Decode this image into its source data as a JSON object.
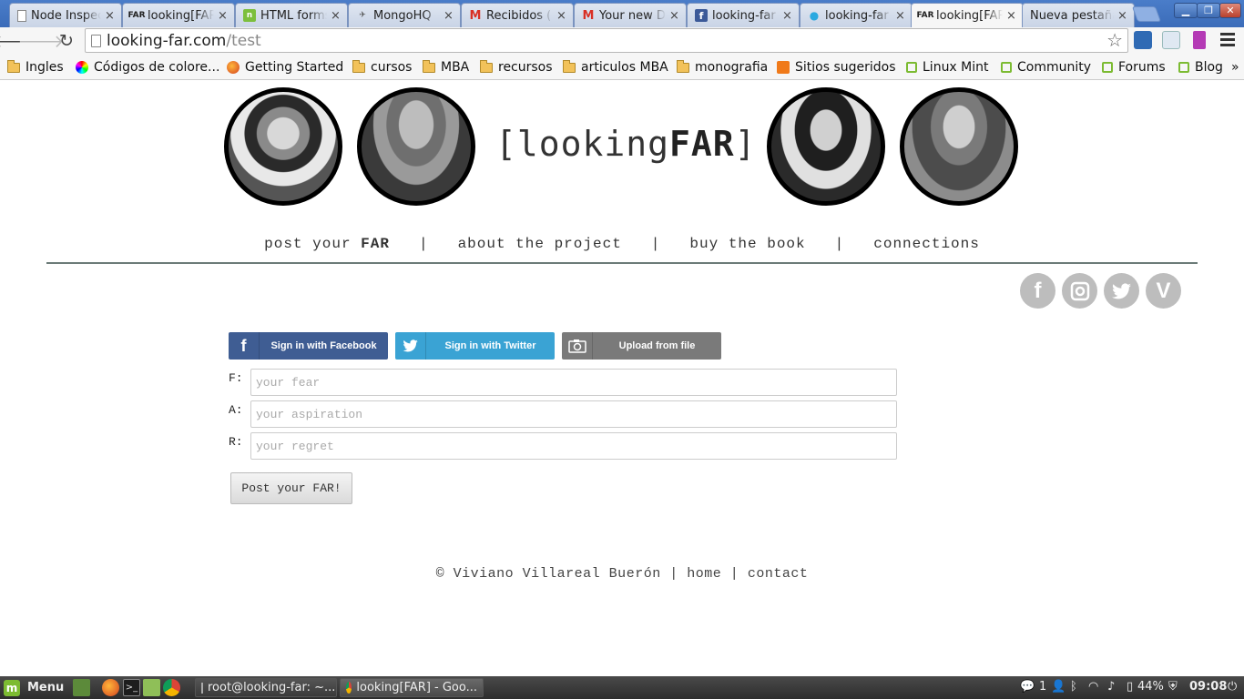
{
  "browser": {
    "tabs": [
      {
        "title": "Node Inspector",
        "icon": "page-icon",
        "active": false
      },
      {
        "title": "looking[FAR]",
        "icon": "far-icon",
        "active": false
      },
      {
        "title": "HTML forms",
        "icon": "node-icon",
        "active": false
      },
      {
        "title": "MongoHQ",
        "icon": "rocket-icon",
        "active": false
      },
      {
        "title": "Recibidos (",
        "icon": "gmail-icon",
        "active": false
      },
      {
        "title": "Your new D",
        "icon": "gmail-icon",
        "active": false
      },
      {
        "title": "looking-far",
        "icon": "facebook-icon",
        "active": false
      },
      {
        "title": "looking-far |",
        "icon": "twitter-icon",
        "active": false
      },
      {
        "title": "looking[FAR]",
        "icon": "far-icon",
        "active": true
      },
      {
        "title": "Nueva pestaña",
        "icon": "none",
        "active": false
      }
    ],
    "close_glyph": "×",
    "url_host": "looking-far.com",
    "url_path": "/test",
    "bookmarks": [
      {
        "label": "Ingles",
        "icon": "folder-icon"
      },
      {
        "label": "Códigos de colore...",
        "icon": "colorwheel-icon"
      },
      {
        "label": "Getting Started",
        "icon": "firefox-icon"
      },
      {
        "label": "cursos",
        "icon": "folder-icon"
      },
      {
        "label": "MBA",
        "icon": "folder-icon"
      },
      {
        "label": "recursos",
        "icon": "folder-icon"
      },
      {
        "label": "articulos MBA",
        "icon": "folder-icon"
      },
      {
        "label": "monografia",
        "icon": "folder-icon"
      },
      {
        "label": "Sitios sugeridos",
        "icon": "suggested-icon"
      },
      {
        "label": "Linux Mint",
        "icon": "mint-icon"
      },
      {
        "label": "Community",
        "icon": "mint-icon"
      },
      {
        "label": "Forums",
        "icon": "mint-icon"
      },
      {
        "label": "Blog",
        "icon": "mint-icon"
      }
    ],
    "bookmarks_more": "»"
  },
  "site": {
    "logo_pre": "[looking",
    "logo_bold": "FAR",
    "logo_post": "]",
    "nav": {
      "post_pre": "post your ",
      "post_bold": "FAR",
      "about": "about the project",
      "buy": "buy the book",
      "connections": "connections",
      "separator": "|"
    },
    "social": [
      "facebook-icon",
      "instagram-icon",
      "twitter-icon",
      "vimeo-icon"
    ],
    "signin": {
      "facebook": "Sign in with Facebook",
      "twitter": "Sign in with Twitter",
      "upload": "Upload from file"
    },
    "form": {
      "f_label": "F:",
      "a_label": "A:",
      "r_label": "R:",
      "f_placeholder": "your fear",
      "a_placeholder": "your aspiration",
      "r_placeholder": "your regret",
      "submit": "Post your FAR!"
    },
    "footer": {
      "copyright": "© Viviano Villareal Buerón",
      "sep": "|",
      "home": "home",
      "contact": "contact"
    }
  },
  "taskbar": {
    "menu_label": "Menu",
    "tasks": [
      {
        "label": "root@looking-far: ~...",
        "icon": "terminal-icon",
        "active": false
      },
      {
        "label": "looking[FAR] - Goo...",
        "icon": "chrome-icon",
        "active": true
      }
    ],
    "user_count": "1",
    "battery": "44%",
    "clock": "09:08"
  }
}
